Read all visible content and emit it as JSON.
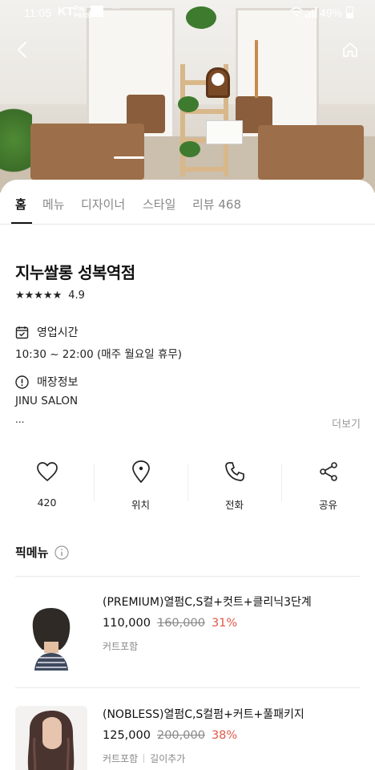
{
  "status_bar": {
    "time": "11:05",
    "carrier": "KT",
    "pay_line1": "Pay",
    "pay_line2": "PASS",
    "more": "···",
    "battery": "49%"
  },
  "tabs": [
    {
      "label": "홈",
      "active": true
    },
    {
      "label": "메뉴"
    },
    {
      "label": "디자이너"
    },
    {
      "label": "스타일"
    },
    {
      "label": "리뷰 468"
    }
  ],
  "shop": {
    "name": "지누쌀롱 성복역점",
    "stars": "★★★★★",
    "rating": "4.9",
    "hours_label": "영업시간",
    "hours": "10:30 ~ 22:00 (매주 월요일 휴무)",
    "info_label": "매장정보",
    "info_text": "JINU SALON",
    "info_more_line": "...",
    "more_label": "더보기"
  },
  "actions": [
    {
      "label": "420",
      "icon": "heart-icon"
    },
    {
      "label": "위치",
      "icon": "location-pin-icon"
    },
    {
      "label": "전화",
      "icon": "phone-icon"
    },
    {
      "label": "공유",
      "icon": "share-icon"
    }
  ],
  "pick_menu": {
    "title": "픽메뉴",
    "items": [
      {
        "name": "(PREMIUM)열펌C,S컬+컷트+클리닉3단계",
        "price": "110,000",
        "original": "160,000",
        "discount": "31%",
        "notes": [
          "커트포함"
        ]
      },
      {
        "name": "(NOBLESS)열펌C,S컬펌+커트+풀패키지",
        "price": "125,000",
        "original": "200,000",
        "discount": "38%",
        "notes": [
          "커트포함",
          "길이추가"
        ]
      }
    ]
  },
  "colors": {
    "accent_discount": "#e0584a",
    "muted": "#888888",
    "text": "#111111"
  }
}
